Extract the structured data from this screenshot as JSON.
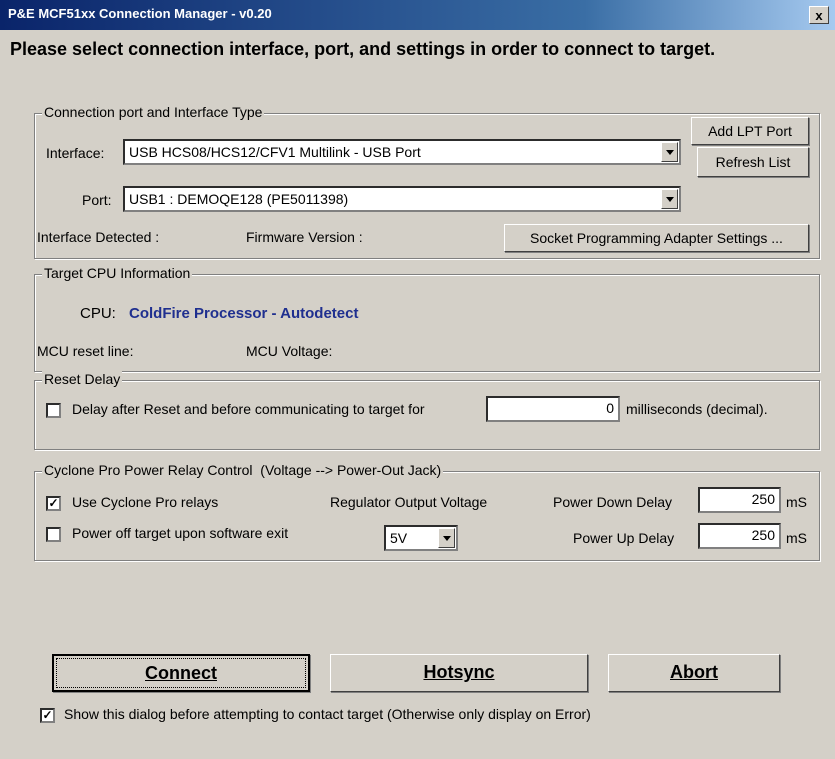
{
  "window": {
    "title": "P&E MCF51xx Connection Manager - v0.20",
    "close_label": "x"
  },
  "instruction": "Please select connection interface, port, and settings in order to connect to target.",
  "connection": {
    "legend": "Connection port and Interface Type",
    "interface_label": "Interface:",
    "interface_value": "USB HCS08/HCS12/CFV1 Multilink - USB Port",
    "port_label": "Port:",
    "port_value": "USB1 : DEMOQE128 (PE5011398)",
    "add_lpt_label": "Add LPT Port",
    "refresh_label": "Refresh List",
    "detected_label": "Interface Detected :",
    "firmware_label": "Firmware Version :",
    "socket_label": "Socket Programming Adapter Settings ..."
  },
  "cpu": {
    "legend": "Target CPU Information",
    "cpu_label": "CPU:",
    "cpu_value": "ColdFire Processor - Autodetect",
    "cpu_value_color": "#1f2f8f",
    "reset_line_label": "MCU reset line:",
    "voltage_label": "MCU Voltage:"
  },
  "reset_delay": {
    "legend": "Reset Delay",
    "checkbox_label": "Delay after Reset and before communicating to target for",
    "checked": false,
    "value": "0",
    "unit": "milliseconds (decimal)."
  },
  "power": {
    "legend": "Cyclone Pro Power Relay Control  (Voltage --> Power-Out Jack)",
    "use_relays_label": "Use Cyclone Pro relays",
    "use_relays_checked": true,
    "regulator_label": "Regulator Output Voltage",
    "power_off_label": "Power off target upon software exit",
    "power_off_checked": false,
    "voltage_value": "5V",
    "power_down_label": "Power Down Delay",
    "power_down_value": "250",
    "power_up_label": "Power Up Delay",
    "power_up_value": "250",
    "unit": "mS"
  },
  "buttons": {
    "connect_label": "Connect",
    "hotsync_label": "Hotsync",
    "abort_label": "Abort"
  },
  "footer": {
    "show_dialog_label": "Show this dialog before attempting to contact target (Otherwise only display on Error)",
    "show_dialog_checked": true,
    "check_glyph": "✓"
  }
}
